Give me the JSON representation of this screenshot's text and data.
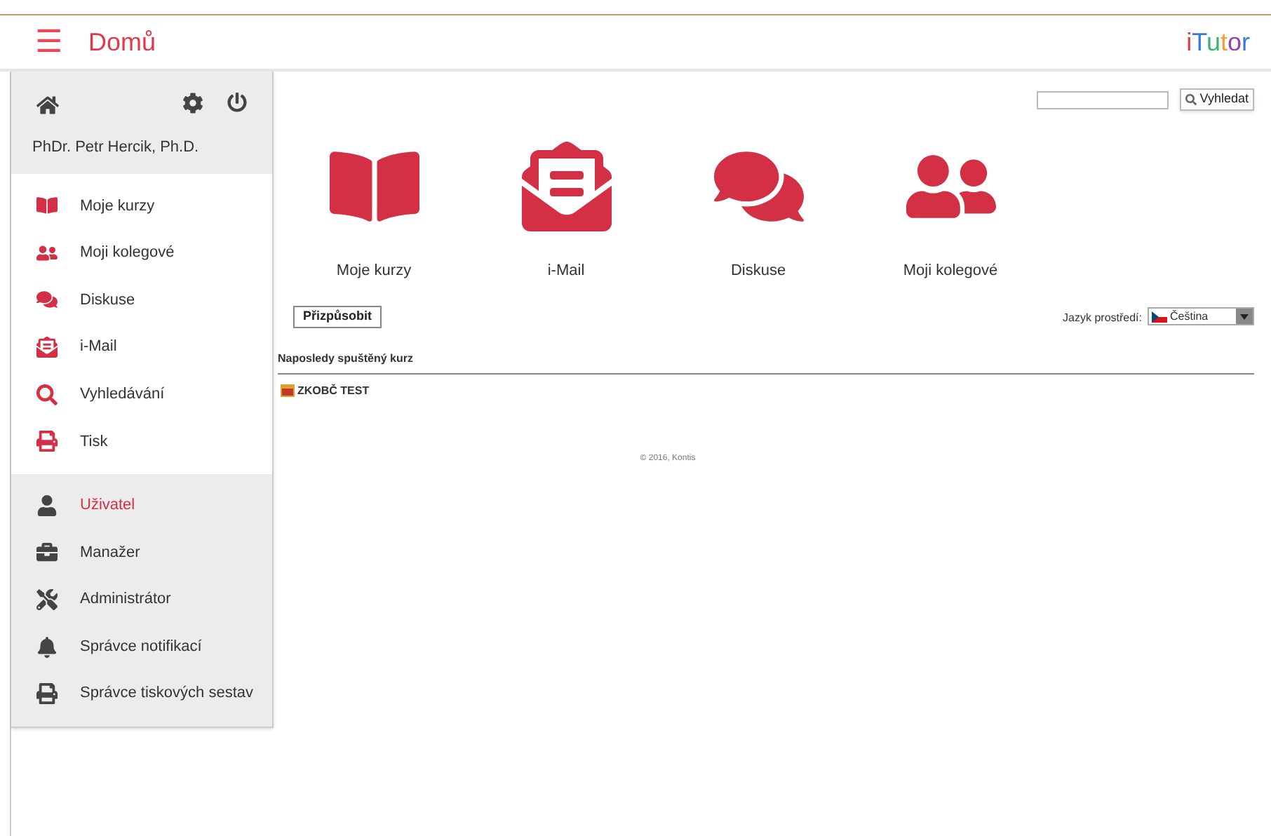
{
  "header": {
    "menu_icon": "☰",
    "title": "Domů",
    "logo": "iTutor"
  },
  "sidebar": {
    "user_name": "PhDr. Petr Hercik, Ph.D.",
    "items": [
      {
        "label": "Moje kurzy",
        "kind": "primary",
        "selected": false
      },
      {
        "label": "Moji kolegové",
        "kind": "primary",
        "selected": false
      },
      {
        "label": "Diskuse",
        "kind": "primary",
        "selected": false
      },
      {
        "label": "i-Mail",
        "kind": "primary",
        "selected": false
      },
      {
        "label": "Vyhledávání",
        "kind": "primary",
        "selected": false
      },
      {
        "label": "Tisk",
        "kind": "primary",
        "selected": false
      },
      {
        "label": "Uživatel",
        "kind": "role",
        "selected": true
      },
      {
        "label": "Manažer",
        "kind": "role",
        "selected": false
      },
      {
        "label": "Administrátor",
        "kind": "role",
        "selected": false
      },
      {
        "label": "Správce notifikací",
        "kind": "role",
        "selected": false
      },
      {
        "label": "Správce tiskových sestav",
        "kind": "role",
        "selected": false
      }
    ]
  },
  "search": {
    "button": "Vyhledat"
  },
  "tiles": [
    {
      "label": "Moje kurzy"
    },
    {
      "label": "i-Mail"
    },
    {
      "label": "Diskuse"
    },
    {
      "label": "Moji kolegové"
    }
  ],
  "customize_button": "Přizpůsobit",
  "language": {
    "label": "Jazyk prostředí:",
    "value": "Čeština"
  },
  "recent": {
    "heading": "Naposledy spuštěný kurz",
    "course": "ZKOBČ TEST"
  },
  "footer": "© 2016, Kontis"
}
